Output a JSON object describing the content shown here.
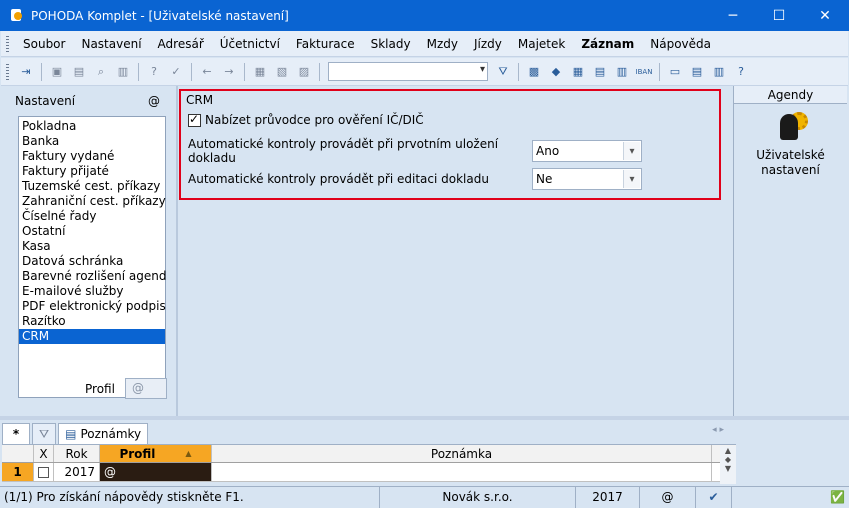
{
  "window": {
    "title": "POHODA Komplet - [Uživatelské nastavení]",
    "minimize": "─",
    "maximize": "☐",
    "close": "✕"
  },
  "menu": [
    "Soubor",
    "Nastavení",
    "Adresář",
    "Účetnictví",
    "Fakturace",
    "Sklady",
    "Mzdy",
    "Jízdy",
    "Majetek",
    "Záznam",
    "Nápověda"
  ],
  "left_panel": {
    "label": "Nastavení",
    "at_symbol": "@",
    "items": [
      "Pokladna",
      "Banka",
      "Faktury vydané",
      "Faktury přijaté",
      "Tuzemské cest. příkazy",
      "Zahraniční cest. příkazy",
      "Číselné řady",
      "Ostatní",
      "Kasa",
      "Datová schránka",
      "Barevné rozlišení agend",
      "E-mailové služby",
      "PDF elektronický podpis",
      "Razítko",
      "CRM"
    ],
    "selected_index": 14,
    "profile_label": "Profil",
    "profile_value": "@"
  },
  "crm": {
    "title": "CRM",
    "checkbox_label": "Nabízet průvodce pro ověření IČ/DIČ",
    "checkbox_checked": true,
    "row1_label": "Automatické kontroly provádět při prvotním uložení dokladu",
    "row1_value": "Ano",
    "row2_label": "Automatické kontroly provádět při editaci dokladu",
    "row2_value": "Ne"
  },
  "agendy": {
    "header": "Agendy",
    "item_label_line1": "Uživatelské",
    "item_label_line2": "nastavení"
  },
  "bottom": {
    "tab_star": "*",
    "tab_notes": "Poznámky",
    "columns": {
      "x": "X",
      "rok": "Rok",
      "profil": "Profil",
      "poznamka": "Poznámka"
    },
    "rows": [
      {
        "num": "1",
        "rok": "2017",
        "profil": "@",
        "poznamka": ""
      }
    ]
  },
  "status": {
    "help": "(1/1) Pro získání nápovědy stiskněte F1.",
    "company": "Novák s.r.o.",
    "year": "2017",
    "at": "@"
  }
}
